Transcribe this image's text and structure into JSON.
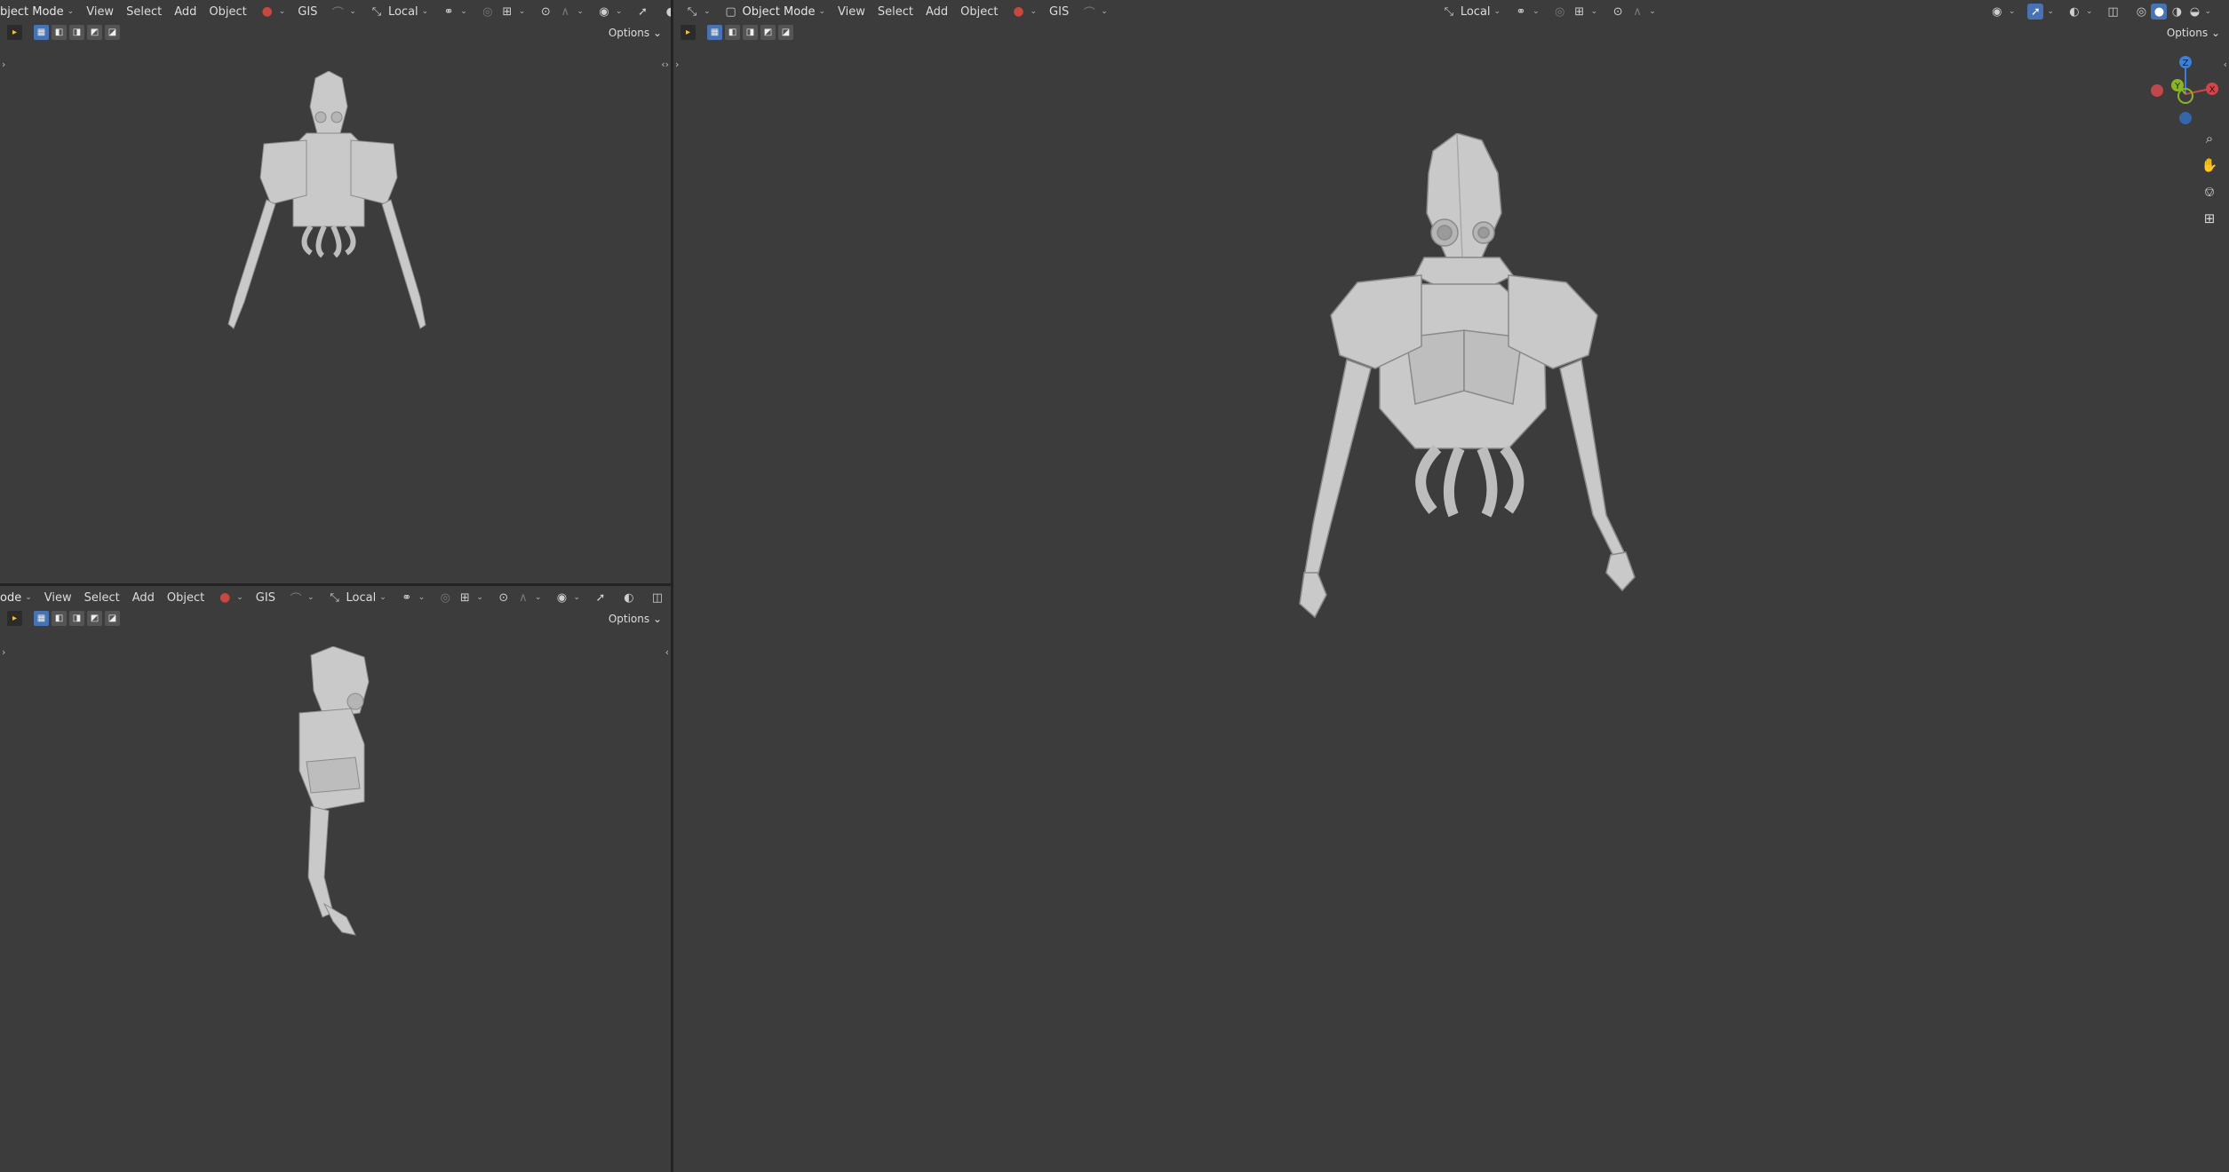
{
  "top_left": {
    "header": {
      "mode": "bject Mode",
      "menus": [
        "View",
        "Select",
        "Add",
        "Object"
      ],
      "gis": "GIS",
      "transform": "Local"
    },
    "options": "Options"
  },
  "bottom_left": {
    "header": {
      "mode": "ode",
      "menus": [
        "View",
        "Select",
        "Add",
        "Object"
      ],
      "gis": "GIS",
      "transform": "Local"
    },
    "options": "Options"
  },
  "main": {
    "header": {
      "mode": "Object Mode",
      "menus": [
        "View",
        "Select",
        "Add",
        "Object"
      ],
      "gis": "GIS",
      "transform": "Local"
    },
    "options": "Options",
    "gizmo": {
      "x_label": "X",
      "y_label": "Y",
      "z_label": "Z"
    }
  },
  "colors": {
    "viewport_bg": "#3c3c3c",
    "accent": "#4772b3",
    "model": "#c9c9c9",
    "axis_x": "#d2454b",
    "axis_y": "#8bb42a",
    "axis_z": "#3f7fd6"
  },
  "icons": [
    "editor-type-icon",
    "object-mode-icon",
    "gis-icon",
    "snap-icon",
    "proportional-icon",
    "overlay-icon",
    "xray-icon",
    "shading-solid-icon",
    "zoom-icon",
    "hand-icon",
    "camera-icon",
    "grid-icon"
  ]
}
